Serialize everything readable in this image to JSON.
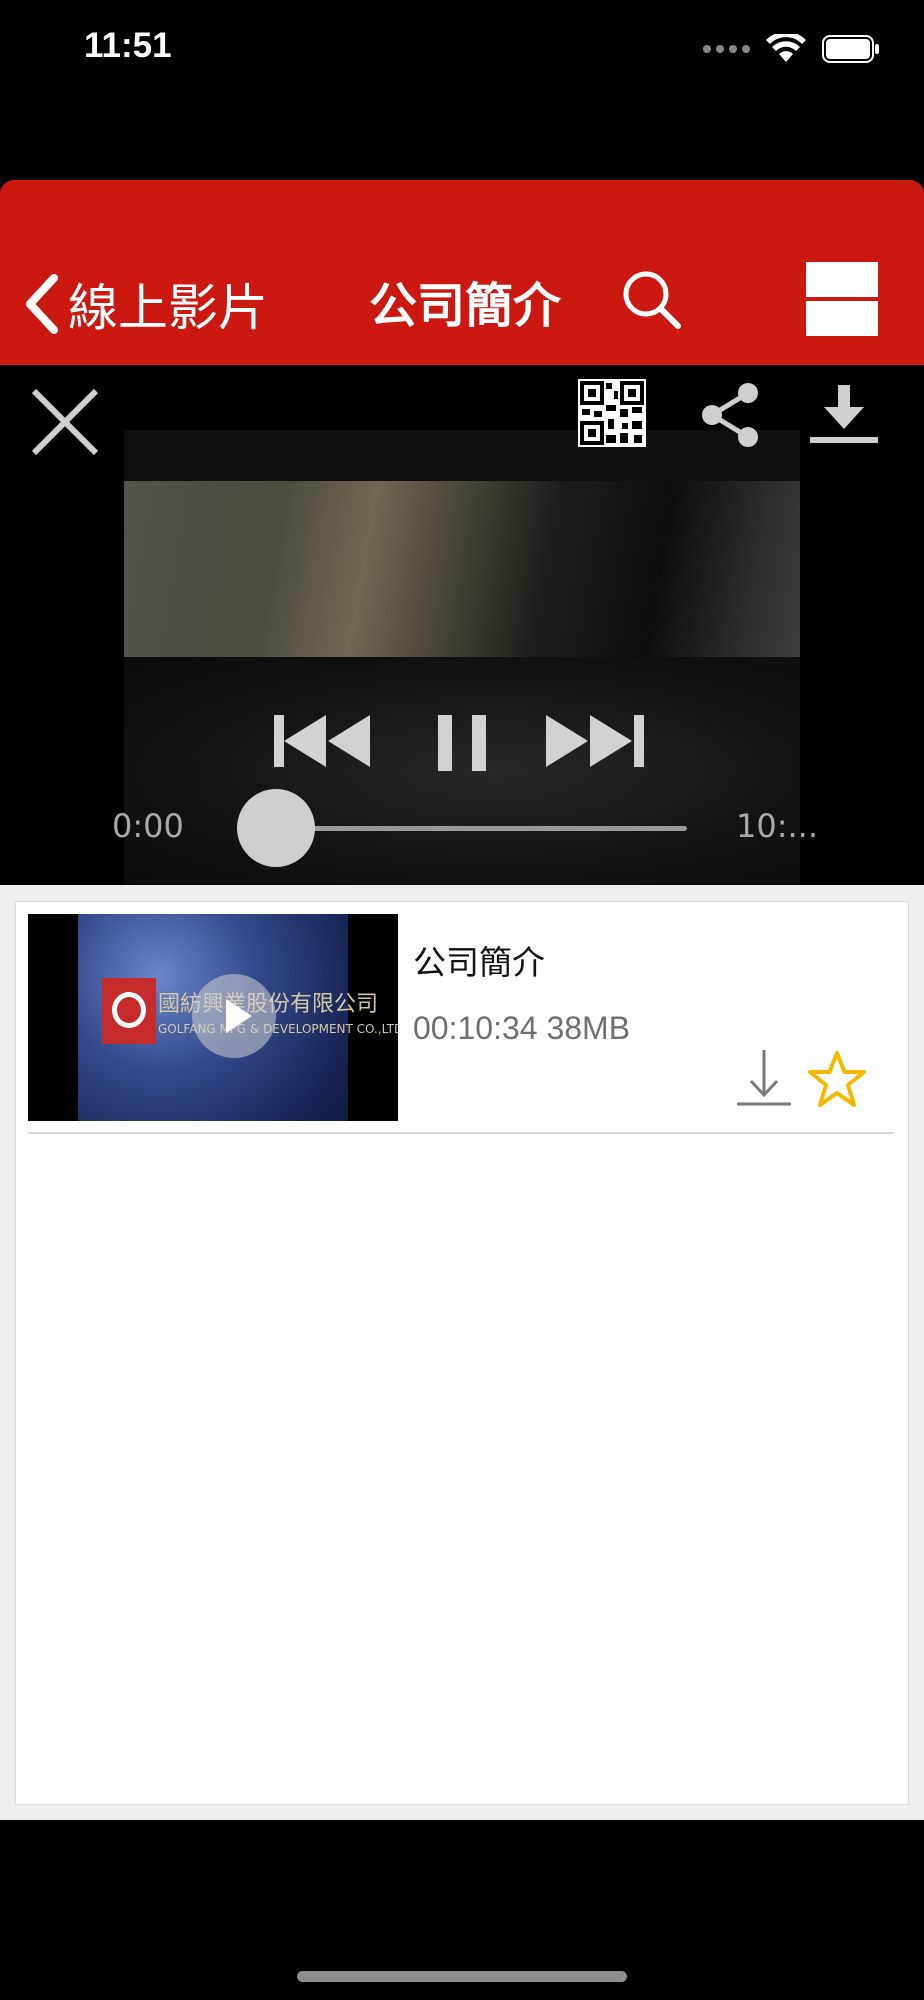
{
  "status_bar": {
    "time": "11:51"
  },
  "nav": {
    "back_label": "線上影片",
    "title": "公司簡介",
    "colors": {
      "background": "#cb1810",
      "text": "#ffffff"
    }
  },
  "player": {
    "current_time": "0:00",
    "total_time": "10:...",
    "progress_fraction": 0.0
  },
  "list": {
    "items": [
      {
        "title": "公司簡介",
        "meta": "00:10:34 38MB",
        "thumbnail": {
          "chinese_name": "國紡興業股份有限公司",
          "english_name": "GOLFANG MFG & DEVELOPMENT CO.,LTD"
        }
      }
    ]
  },
  "icons": [
    "back-chevron-icon",
    "search-icon",
    "menu-icon",
    "close-icon",
    "qr-code-icon",
    "share-icon",
    "download-icon",
    "previous-icon",
    "pause-icon",
    "next-icon",
    "play-icon",
    "star-icon"
  ],
  "accent_colors": {
    "star": "#f5b800",
    "brand_red": "#cb1810"
  }
}
